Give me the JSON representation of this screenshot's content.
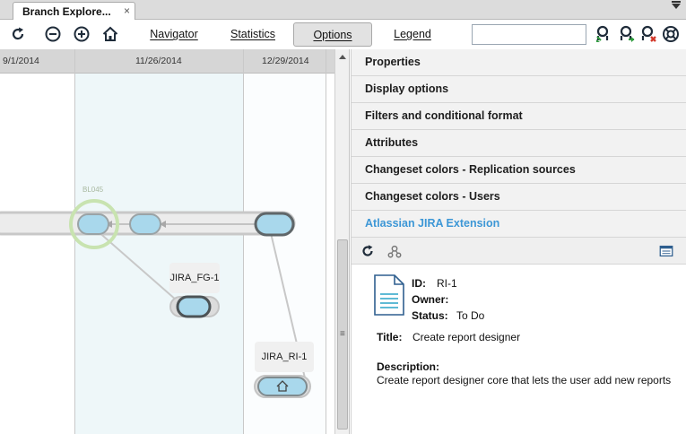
{
  "tab": {
    "title": "Branch Explore...",
    "close": "×"
  },
  "toolbar": {
    "icons": [
      "refresh-icon",
      "zoom-out-icon",
      "zoom-in-icon",
      "home-icon"
    ],
    "buttons": [
      {
        "label": "Navigator",
        "active": false
      },
      {
        "label": "Statistics",
        "active": false
      },
      {
        "label": "Options",
        "active": true
      },
      {
        "label": "Legend",
        "active": false
      }
    ],
    "search": {
      "value": "",
      "placeholder": ""
    },
    "right_icons": [
      "pull-icon",
      "push-icon",
      "remove-sync-icon",
      "help-icon"
    ]
  },
  "explorer": {
    "dates": [
      "9/1/2014",
      "11/26/2014",
      "12/29/2014"
    ],
    "label_text": "BL045",
    "branches": [
      "JIRA_FG-1",
      "JIRA_RI-1"
    ],
    "colors": {
      "band": "#eef7f9",
      "changeset_fill": "#a9d8ec",
      "changeset_border": "#7f8a8e",
      "highlight": "#c8e3b0"
    }
  },
  "options": {
    "sections": [
      {
        "label": "Properties",
        "active": false
      },
      {
        "label": "Display options",
        "active": false
      },
      {
        "label": "Filters and conditional format",
        "active": false
      },
      {
        "label": "Attributes",
        "active": false
      },
      {
        "label": "Changeset colors - Replication sources",
        "active": false
      },
      {
        "label": "Changeset colors - Users",
        "active": false
      },
      {
        "label": "Atlassian JIRA Extension",
        "active": true
      }
    ],
    "active_color": "#3d97d6"
  },
  "issue": {
    "id_label": "ID:",
    "id": "RI-1",
    "owner_label": "Owner:",
    "owner": "",
    "status_label": "Status:",
    "status": "To Do",
    "title_label": "Title:",
    "title": "Create report designer",
    "description_label": "Description:",
    "description": "Create report designer core that lets the user add new reports"
  }
}
